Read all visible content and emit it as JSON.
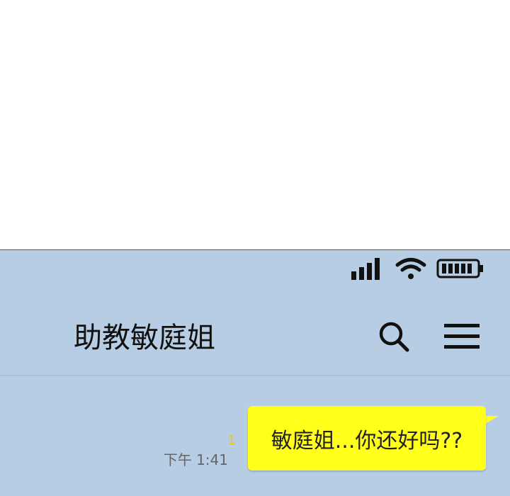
{
  "header": {
    "title": "助教敏庭姐"
  },
  "status_bar": {
    "signal_icon": "signal-bars-icon",
    "wifi_icon": "wifi-icon",
    "battery_icon": "battery-icon",
    "battery_level": 1.0
  },
  "actions": {
    "search_icon": "search-icon",
    "menu_icon": "hamburger-menu-icon"
  },
  "messages": [
    {
      "text": "敏庭姐...你还好吗??",
      "unread": "1",
      "time": "下午 1:41"
    }
  ],
  "colors": {
    "chat_background": "#b6cde3",
    "bubble": "#ffff1a",
    "unread": "#f0c800",
    "timestamp": "#666666"
  }
}
